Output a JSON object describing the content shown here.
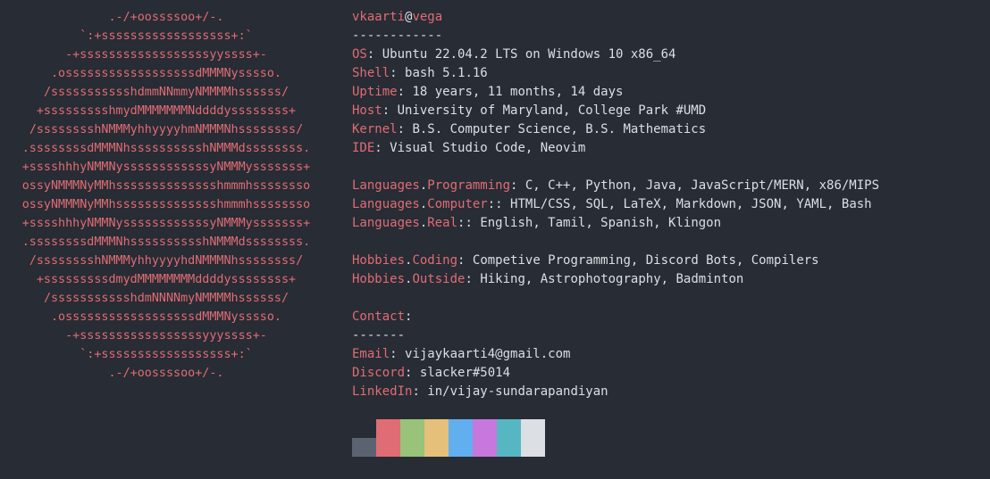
{
  "ascii_logo": {
    "lines": [
      ".-/+oossssoo+/-.",
      "`:+ssssssssssssssssss+:`",
      "-+ssssssssssssssssssyyssss+-",
      ".ossssssssssssssssssdMMMNysssso.",
      "/ssssssssssshdmmNNmmyNMMMMhssssss/",
      "+ssssssssshmydMMMMMMMNddddyssssssss+",
      "/sssssssshNMMMyhhyyyyhmNMMMNhssssssss/",
      ".ssssssssdMMMNhsssssssssshNMMMdssssssss.",
      "+sssshhhyNMMNyssssssssssssyNMMMysssssss+",
      "ossyNMMMNyMMhsssssssssssssshmmmhssssssso",
      "ossyNMMMNyMMhsssssssssssssshmmmhssssssso",
      "+sssshhhyNMMNyssssssssssssyNMMMysssssss+",
      ".ssssssssdMMMNhsssssssssshNMMMdssssssss.",
      "/sssssssshNMMMyhhyyyyhdNMMMNhssssssss/",
      "+sssssssssdmydMMMMMMMMddddyssssssss+",
      "/ssssssssssshdmNNNNmyNMMMMhssssss/",
      ".ossssssssssssssssssdMMMNysssso.",
      "-+sssssssssssssssssyyyssss+-",
      "`:+ssssssssssssssssss+:`",
      ".-/+oossssoo+/-."
    ]
  },
  "header": {
    "user": "vkaarti",
    "at": "@",
    "host": "vega",
    "separator": "------------"
  },
  "info": [
    {
      "key": "OS",
      "sep": ": ",
      "value": "Ubuntu 22.04.2 LTS on Windows 10 x86_64"
    },
    {
      "key": "Shell",
      "sep": ": ",
      "value": "bash 5.1.16"
    },
    {
      "key": "Uptime",
      "sep": ": ",
      "value": "18 years, 11 months, 14 days"
    },
    {
      "key": "Host",
      "sep": ": ",
      "value": "University of Maryland, College Park #UMD"
    },
    {
      "key": "Kernel",
      "sep": ": ",
      "value": "B.S. Computer Science, B.S. Mathematics"
    },
    {
      "key": "IDE",
      "sep": ": ",
      "value": "Visual Studio Code, Neovim"
    }
  ],
  "languages": [
    {
      "key": "Languages",
      "dot": ".",
      "sub": "Programming",
      "sep": ": ",
      "value": "C, C++, Python, Java, JavaScript/MERN, x86/MIPS"
    },
    {
      "key": "Languages",
      "dot": ".",
      "sub": "Computer",
      "sep": ":: ",
      "value": "HTML/CSS, SQL, LaTeX, Markdown, JSON, YAML, Bash"
    },
    {
      "key": "Languages",
      "dot": ".",
      "sub": "Real",
      "sep": ":: ",
      "value": "English, Tamil, Spanish, Klingon"
    }
  ],
  "hobbies": [
    {
      "key": "Hobbies",
      "dot": ".",
      "sub": "Coding",
      "sep": ": ",
      "value": "Competive Programming, Discord Bots, Compilers"
    },
    {
      "key": "Hobbies",
      "dot": ".",
      "sub": "Outside",
      "sep": ": ",
      "value": "Hiking, Astrophotography, Badminton"
    }
  ],
  "contact": {
    "title": "Contact",
    "colon": ":",
    "separator": "-------",
    "items": [
      {
        "key": "Email",
        "sep": ": ",
        "value": "vijaykaarti4@gmail.com"
      },
      {
        "key": "Discord",
        "sep": ": ",
        "value": "slacker#5014"
      },
      {
        "key": "LinkedIn",
        "sep": ": ",
        "value": "in/vijay-sundarapandiyan"
      }
    ]
  },
  "palette": {
    "colors": [
      "#5c6370",
      "#e06c75",
      "#98c379",
      "#e5c07b",
      "#61afef",
      "#c678dd",
      "#56b6c2",
      "#dcdfe4"
    ],
    "first_fill": 0.5
  }
}
